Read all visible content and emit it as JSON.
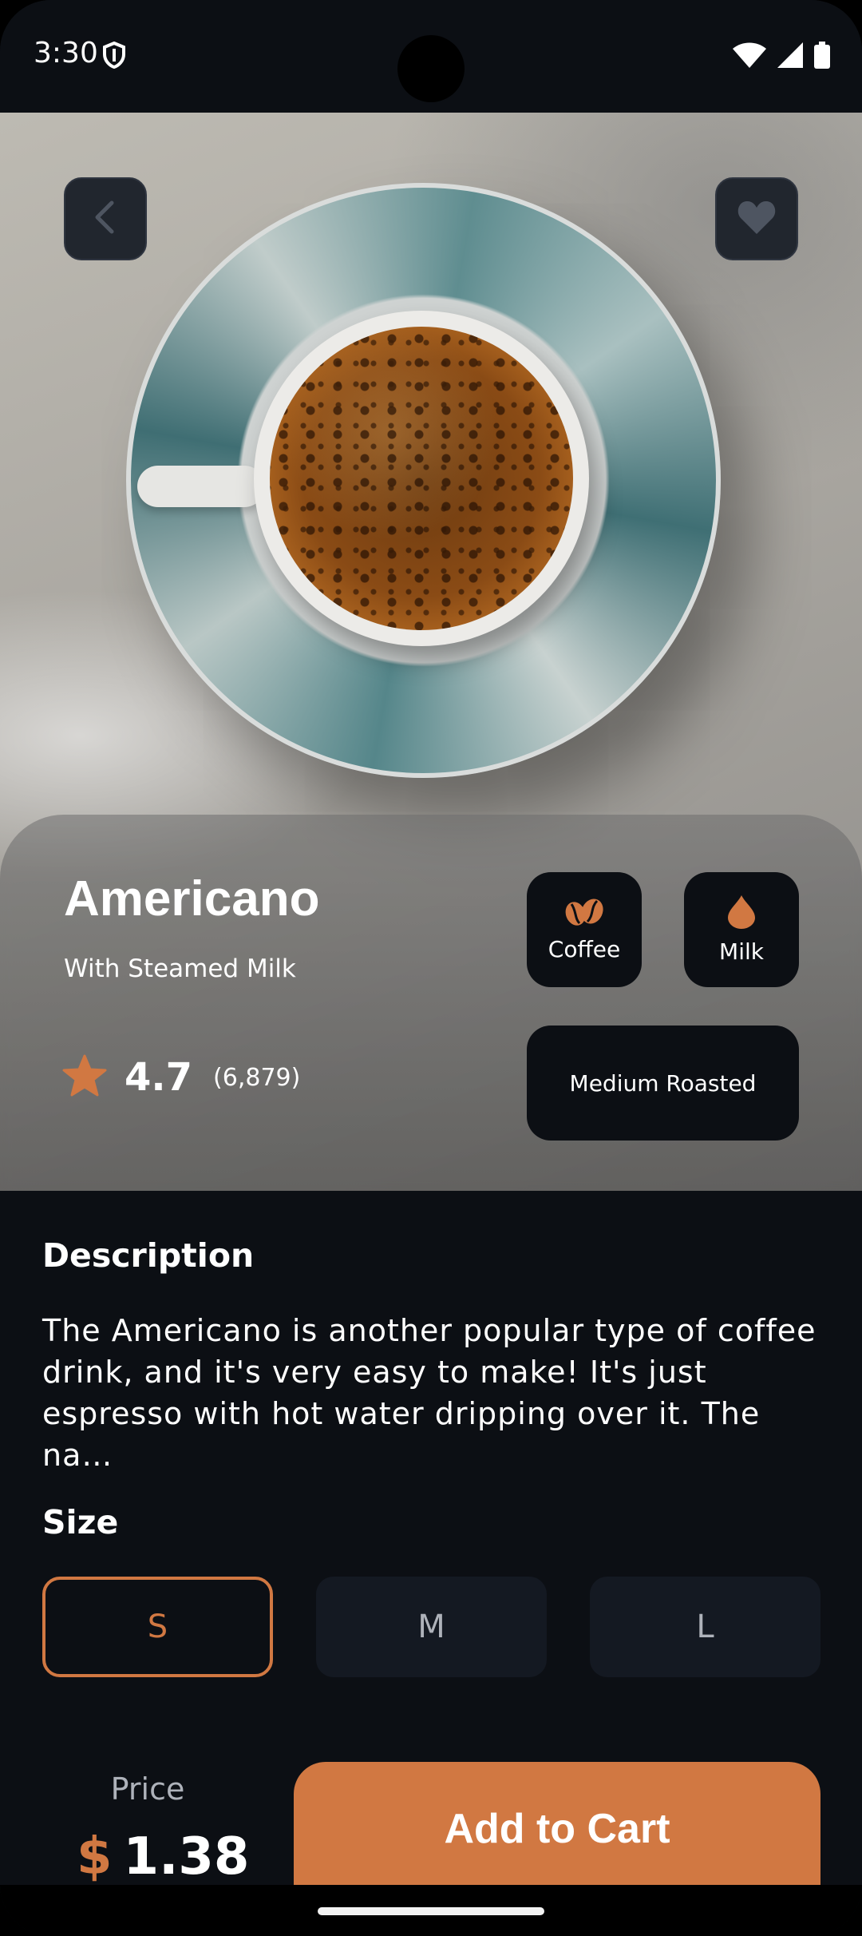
{
  "status": {
    "time": "3:30"
  },
  "product": {
    "name": "Americano",
    "subtitle": "With Steamed Milk",
    "rating": "4.7",
    "rating_count": "(6,879)",
    "ingredients": [
      {
        "label": "Coffee",
        "icon": "coffee-beans-icon"
      },
      {
        "label": "Milk",
        "icon": "milk-drop-icon"
      }
    ],
    "roast": "Medium Roasted"
  },
  "description": {
    "title": "Description",
    "text": "The Americano is another popular type of coffee drink, and it's very easy to make! It's just espresso with hot water dripping over it. The na…"
  },
  "size": {
    "title": "Size",
    "options": [
      "S",
      "M",
      "L"
    ],
    "selected": "S"
  },
  "price": {
    "label": "Price",
    "currency": "$",
    "amount": "1.38"
  },
  "cart": {
    "label": "Add to Cart"
  },
  "colors": {
    "accent": "#D17842",
    "background": "#0C0F14",
    "card": "#141922"
  }
}
